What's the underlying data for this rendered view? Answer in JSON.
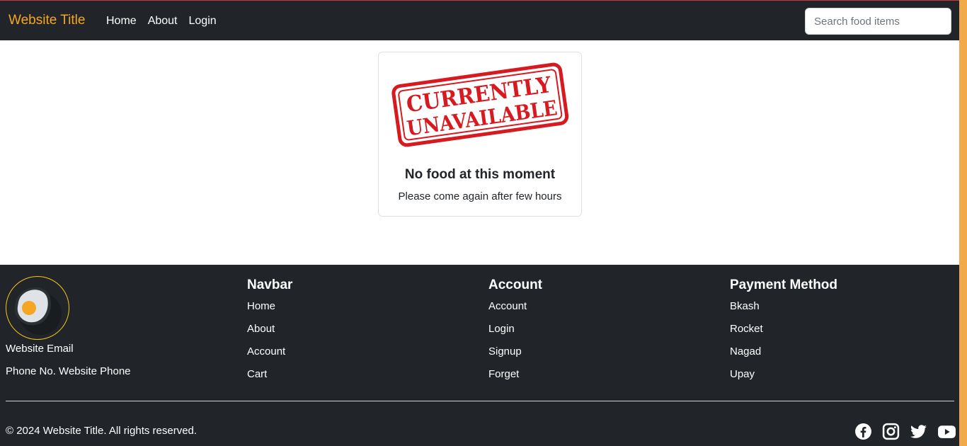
{
  "navbar": {
    "brand": "Website Title",
    "links": [
      "Home",
      "About",
      "Login"
    ],
    "search_placeholder": "Search food items"
  },
  "card": {
    "stamp_line1": "CURRENTLY",
    "stamp_line2": "UNAVAILABLE",
    "title": "No food at this moment",
    "text": "Please come again after few hours"
  },
  "footer": {
    "email_label": "Website Email",
    "phone_label": "Phone No. Website Phone",
    "columns": [
      {
        "title": "Navbar",
        "links": [
          "Home",
          "About",
          "Account",
          "Cart"
        ]
      },
      {
        "title": "Account",
        "links": [
          "Account",
          "Login",
          "Signup",
          "Forget"
        ]
      },
      {
        "title": "Payment Method",
        "links": [
          "Bkash",
          "Rocket",
          "Nagad",
          "Upay"
        ]
      }
    ],
    "copyright": "© 2024 Website Title. All rights reserved.",
    "social_icons": [
      "facebook-icon",
      "instagram-icon",
      "twitter-icon",
      "youtube-icon"
    ]
  },
  "colors": {
    "brand": "#f5a623",
    "dark": "#212529",
    "stamp_red": "#d71920",
    "scroll_accent": "#f2a94a"
  }
}
